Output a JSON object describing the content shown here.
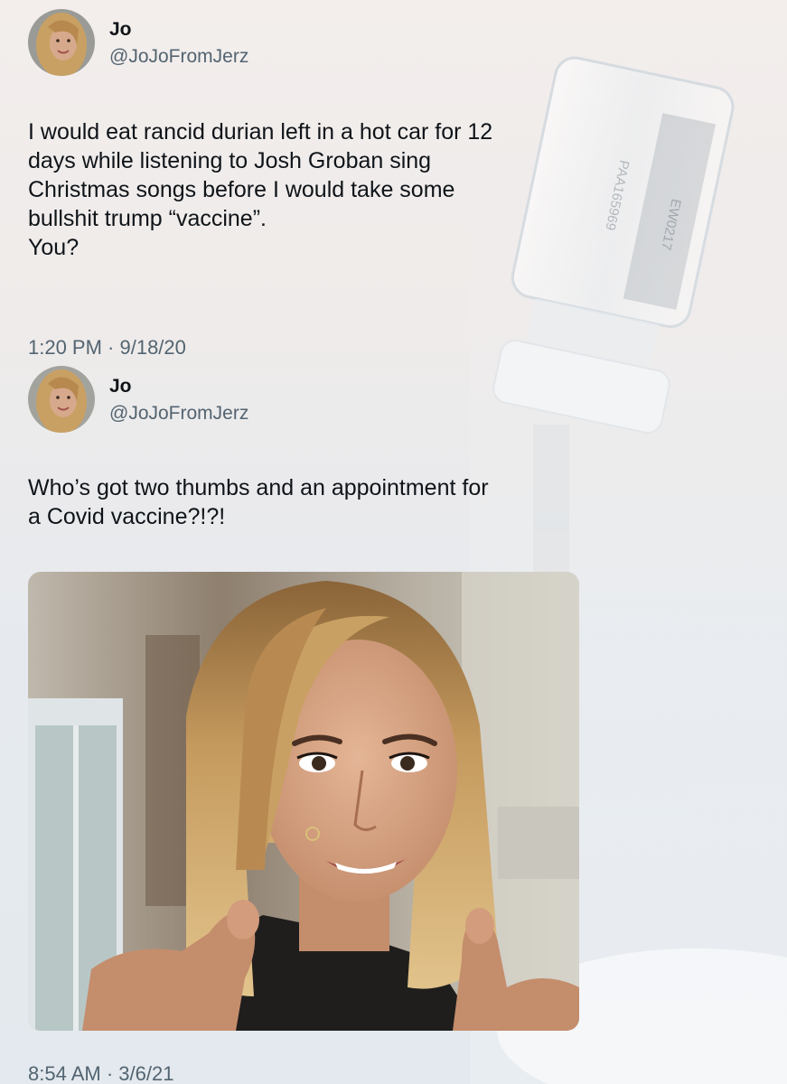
{
  "tweets": [
    {
      "name": "Jo",
      "handle": "@JoJoFromJerz",
      "text": "I would eat rancid durian left in a hot car for 12\ndays while listening to Josh Groban sing\nChristmas songs before I would take some\nbullshit trump “vaccine”.\nYou?",
      "timestamp": "1:20 PM · 9/18/20"
    },
    {
      "name": "Jo",
      "handle": "@JoJoFromJerz",
      "text": "Who’s got two thumbs and an appointment for\na Covid vaccine?!?!",
      "timestamp": "8:54 AM · 3/6/21",
      "photo": "selfie-thumbs-up"
    }
  ],
  "background": {
    "vial_label_lines": [
      "PAA165969",
      "EW0217"
    ]
  },
  "colors": {
    "text": "#0f1419",
    "secondary": "#536471",
    "hair": "#c9a063",
    "skin": "#d7a98c"
  }
}
